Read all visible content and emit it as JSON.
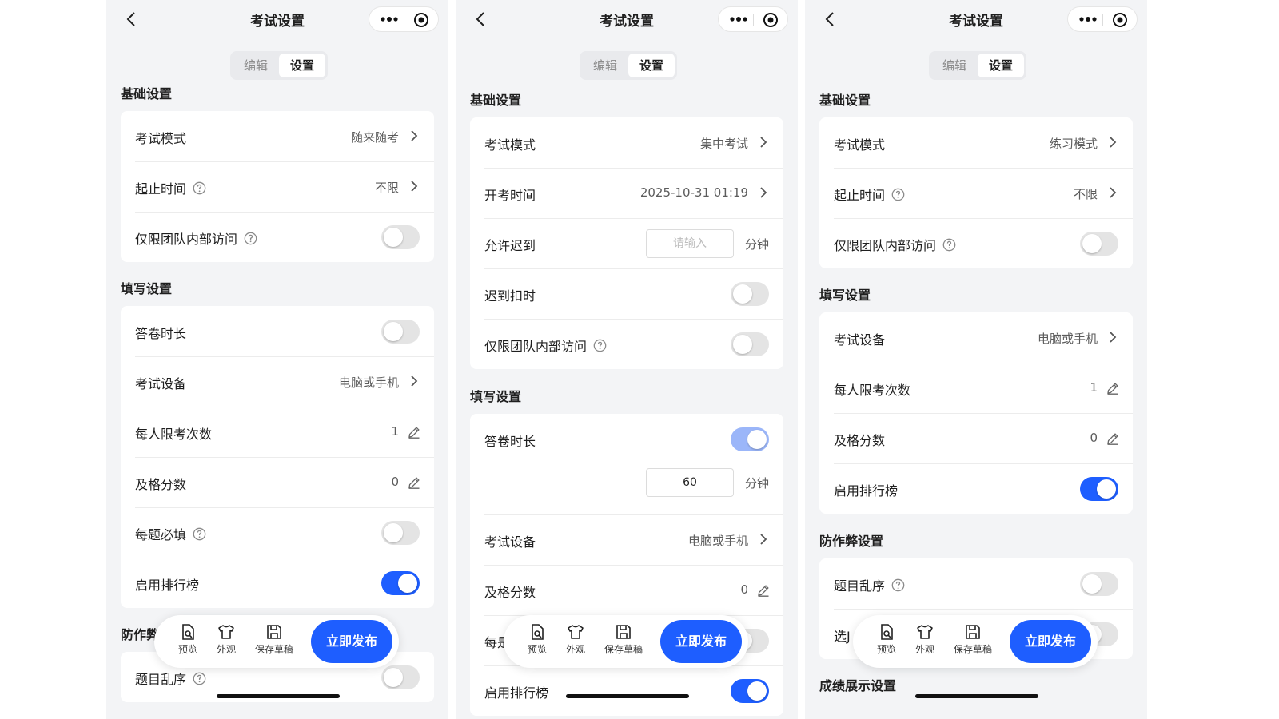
{
  "nav": {
    "title": "考试设置"
  },
  "tabs": {
    "edit": "编辑",
    "settings": "设置"
  },
  "sections": {
    "basic": "基础设置",
    "fill": "填写设置",
    "anticheat": "防作弊设置",
    "result": "成绩展示设置"
  },
  "actionbar": {
    "preview": "预览",
    "appearance": "外观",
    "save_draft": "保存草稿",
    "publish": "立即发布"
  },
  "panel1": {
    "basic": [
      {
        "label": "考试模式",
        "value": "随来随考"
      },
      {
        "label": "起止时间",
        "value": "不限"
      },
      {
        "label": "仅限团队内部访问",
        "toggle": "off"
      }
    ],
    "fill": [
      {
        "label": "答卷时长",
        "toggle": "off"
      },
      {
        "label": "考试设备",
        "value": "电脑或手机"
      },
      {
        "label": "每人限考次数",
        "value": "1"
      },
      {
        "label": "及格分数",
        "value": "0"
      },
      {
        "label": "每题必填",
        "toggle": "off"
      },
      {
        "label": "启用排行榜",
        "toggle": "on"
      }
    ],
    "anticheat_visible": "防作弊",
    "anticheat": [
      {
        "label": "题目乱序",
        "toggle": "off"
      }
    ]
  },
  "panel2": {
    "basic": [
      {
        "label": "考试模式",
        "value": "集中考试"
      },
      {
        "label": "开考时间",
        "value": "2025-10-31 01:19"
      },
      {
        "label": "允许迟到",
        "placeholder": "请输入",
        "unit": "分钟"
      },
      {
        "label": "迟到扣时",
        "toggle": "off"
      },
      {
        "label": "仅限团队内部访问",
        "toggle": "off"
      }
    ],
    "fill": [
      {
        "label": "答卷时长",
        "toggle": "on-light",
        "input_value": "60",
        "unit": "分钟"
      },
      {
        "label": "考试设备",
        "value": "电脑或手机"
      },
      {
        "label": "及格分数",
        "value": "0"
      },
      {
        "label": "每是",
        "toggle": "off"
      },
      {
        "label": "启用排行榜",
        "toggle": "on"
      }
    ]
  },
  "panel3": {
    "basic": [
      {
        "label": "考试模式",
        "value": "练习模式"
      },
      {
        "label": "起止时间",
        "value": "不限"
      },
      {
        "label": "仅限团队内部访问",
        "toggle": "off"
      }
    ],
    "fill": [
      {
        "label": "考试设备",
        "value": "电脑或手机"
      },
      {
        "label": "每人限考次数",
        "value": "1"
      },
      {
        "label": "及格分数",
        "value": "0"
      },
      {
        "label": "启用排行榜",
        "toggle": "on"
      }
    ],
    "anticheat": [
      {
        "label": "题目乱序",
        "toggle": "off"
      },
      {
        "label": "选J",
        "toggle": "off"
      }
    ]
  },
  "colors": {
    "accent": "#1e5eff",
    "accent_light": "#9bb6f9",
    "background": "#f3f4f6"
  }
}
